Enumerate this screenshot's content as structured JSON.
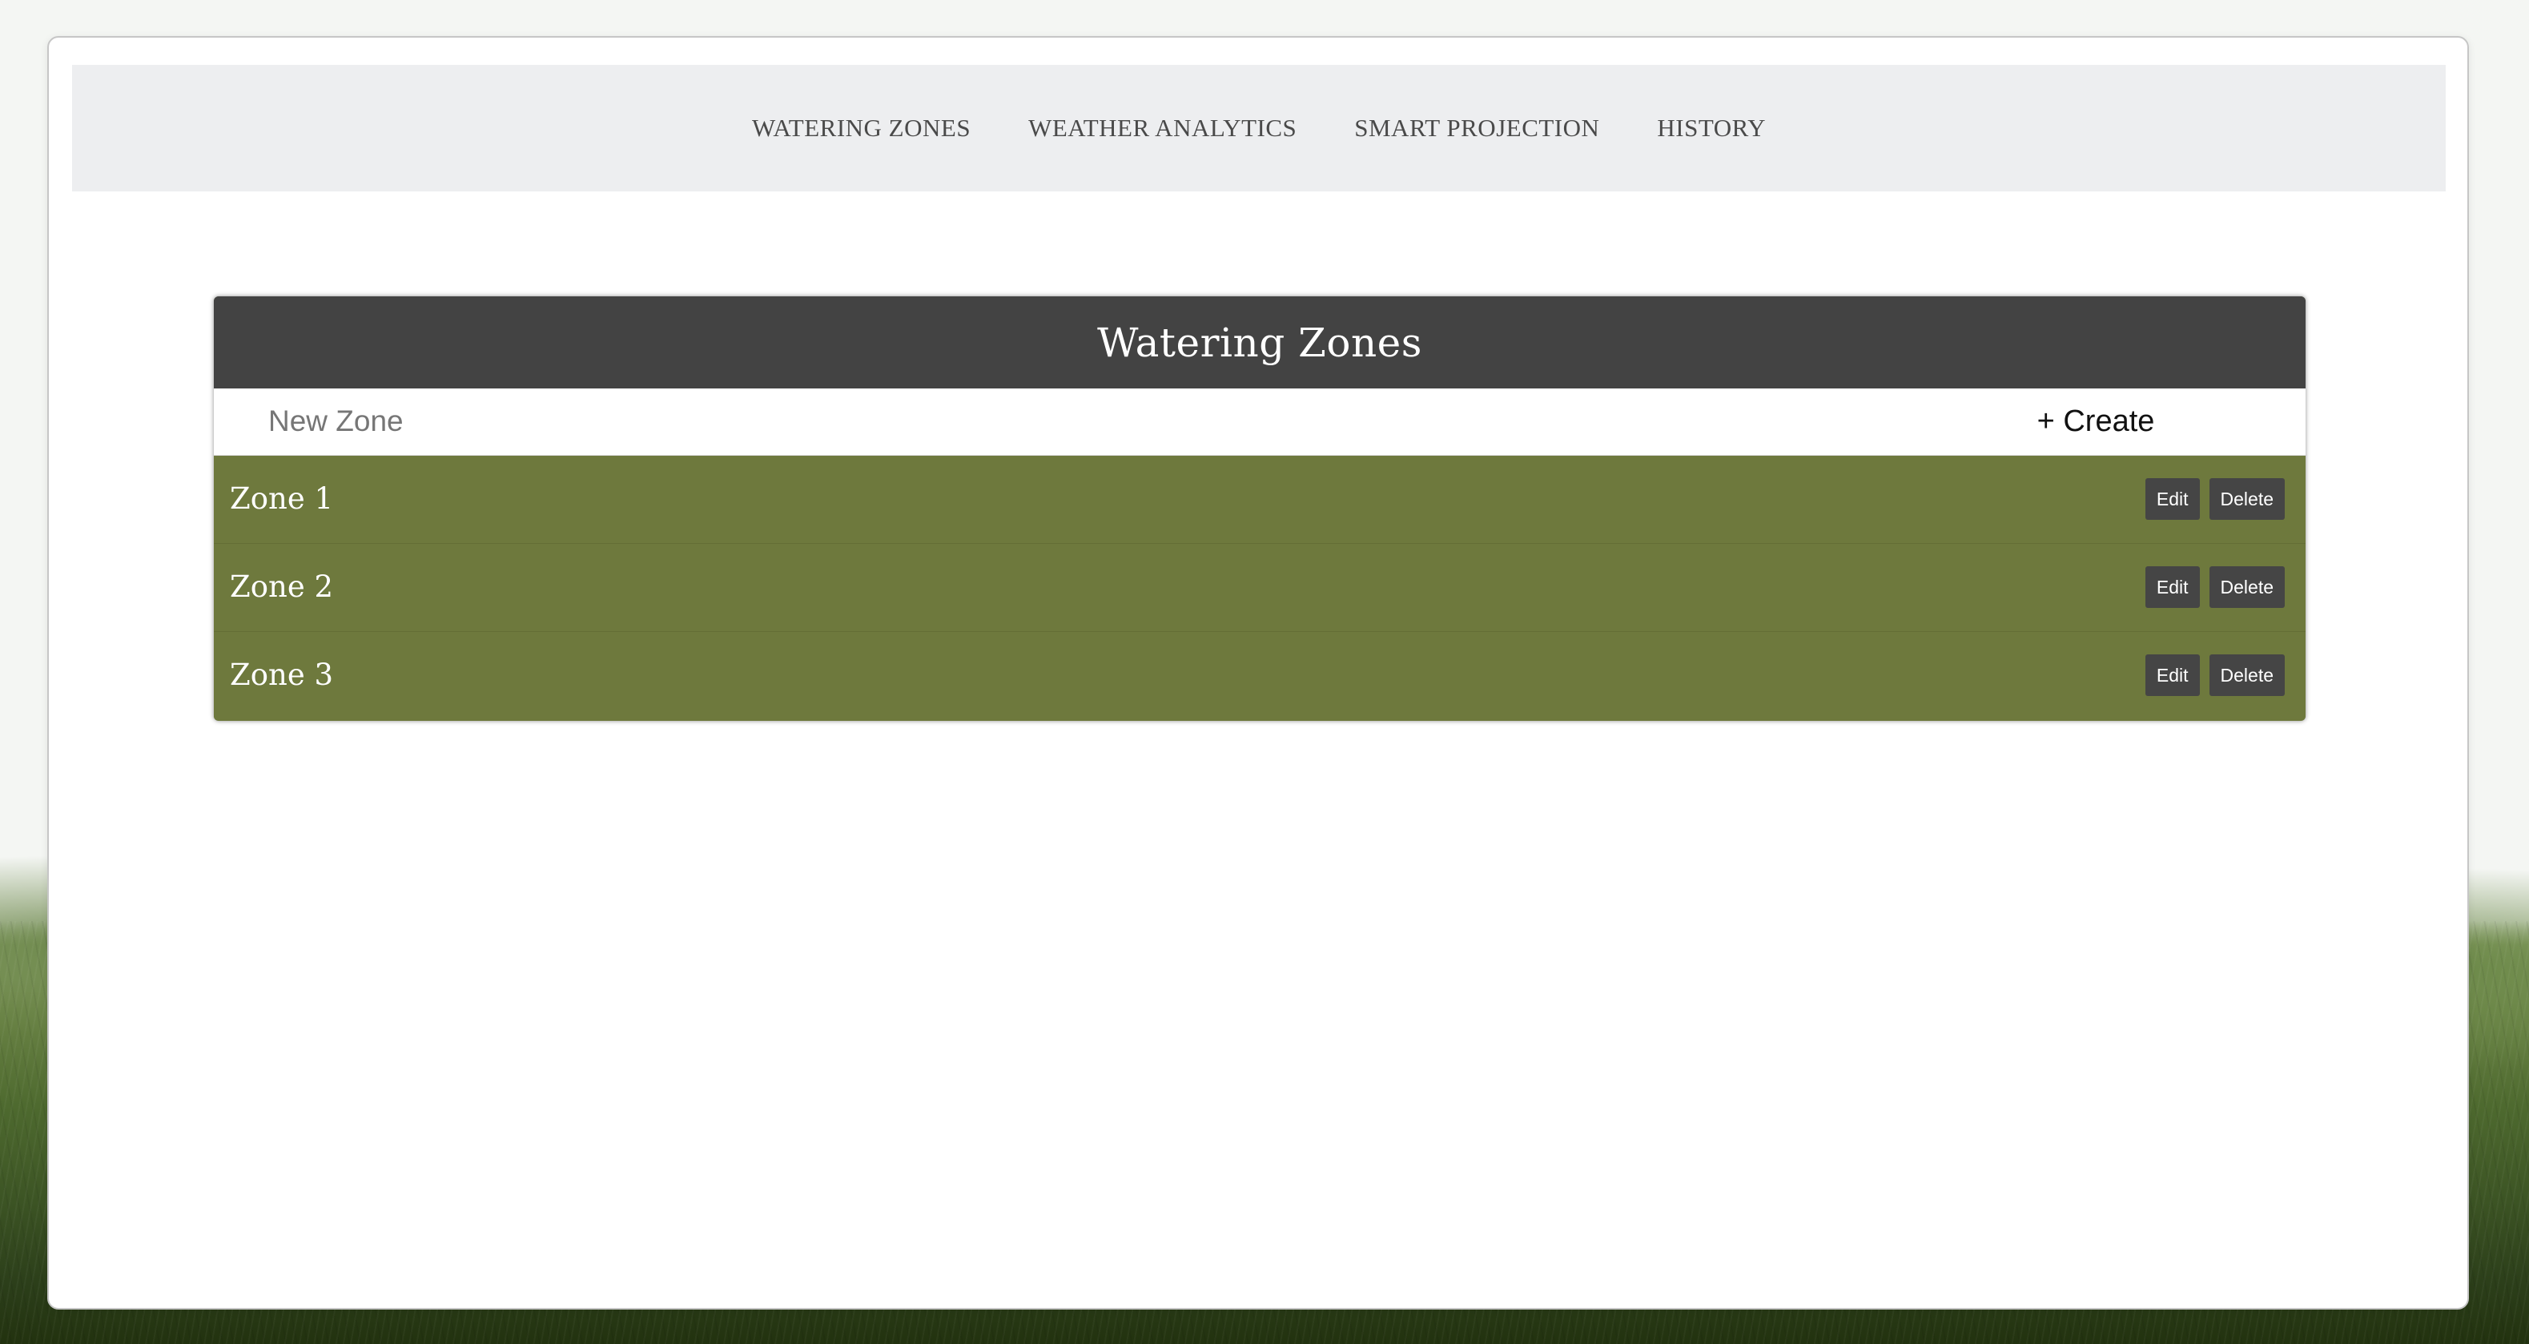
{
  "nav": {
    "items": [
      {
        "label": "WATERING ZONES"
      },
      {
        "label": "WEATHER ANALYTICS"
      },
      {
        "label": "SMART PROJECTION"
      },
      {
        "label": "HISTORY"
      }
    ]
  },
  "panel": {
    "title": "Watering Zones",
    "new_zone_placeholder": "New Zone",
    "new_zone_value": "",
    "create_label": "+ Create"
  },
  "zones": [
    {
      "name": "Zone 1",
      "edit_label": "Edit",
      "delete_label": "Delete"
    },
    {
      "name": "Zone 2",
      "edit_label": "Edit",
      "delete_label": "Delete"
    },
    {
      "name": "Zone 3",
      "edit_label": "Edit",
      "delete_label": "Delete"
    }
  ],
  "colors": {
    "panel_header_bg": "#434343",
    "zone_row_bg": "#6e793d",
    "button_bg": "#454545",
    "nav_bg": "#edeef0"
  }
}
